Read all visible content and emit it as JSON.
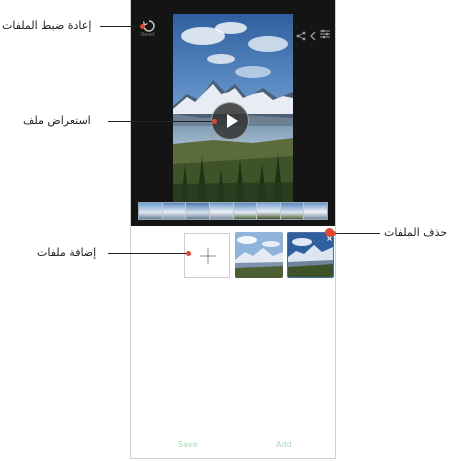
{
  "callouts": {
    "reset_files": "إعادة ضبط الملفات",
    "preview_file": "استعراض ملف",
    "delete_files": "حذف الملفات",
    "add_files": "إضافة ملفات"
  },
  "editor": {
    "reset_label": "Reset"
  },
  "bottom_bar": {
    "left_label": "Save",
    "right_label": "Add"
  },
  "colors": {
    "callout_dot": "#e4472b",
    "editor_bg": "#141414",
    "bottom_text": "#a7d9b9"
  }
}
